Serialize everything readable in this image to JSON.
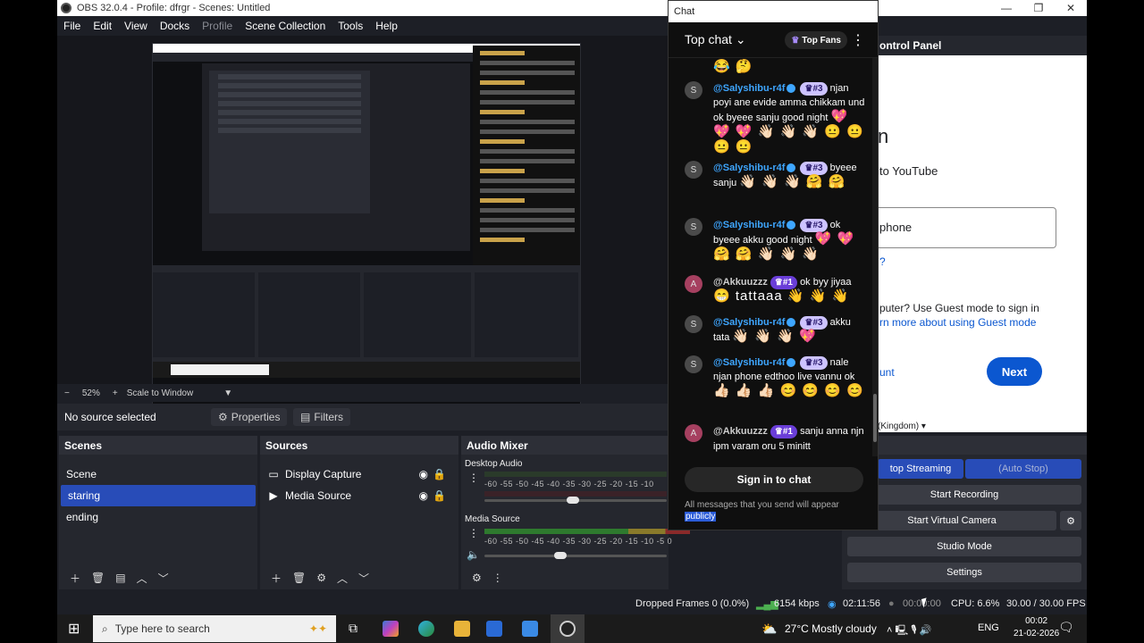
{
  "window": {
    "title": "OBS 32.0.4 - Profile: dfrgr - Scenes: Untitled",
    "minimize": "—",
    "maximize": "❐",
    "close": "✕"
  },
  "menu": [
    "File",
    "Edit",
    "View",
    "Docks",
    "Profile",
    "Scene Collection",
    "Tools",
    "Help"
  ],
  "zoom": {
    "minus": "−",
    "value": "52%",
    "plus": "+",
    "mode": "Scale to Window",
    "caret": "▼"
  },
  "properties_row": {
    "no_source": "No source selected",
    "properties": "Properties",
    "filters": "Filters"
  },
  "scenes": {
    "header": "Scenes",
    "items": [
      "Scene",
      "staring",
      "ending"
    ],
    "selected_index": 1
  },
  "sources": {
    "header": "Sources",
    "items": [
      {
        "name": "Display Capture",
        "icon": "monitor-icon"
      },
      {
        "name": "Media Source",
        "icon": "play-icon"
      }
    ]
  },
  "audio_mixer": {
    "header": "Audio Mixer",
    "channels": [
      {
        "name": "Desktop Audio",
        "scale": "-60 -55 -50 -45 -40 -35 -30 -25 -20 -15 -10",
        "volume": 0.45
      },
      {
        "name": "Media Source",
        "scale": "-60 -55 -50 -45 -40 -35 -30 -25 -20 -15 -10 -5 0",
        "volume": 0.38
      }
    ]
  },
  "controls": {
    "header_suffix": "ols",
    "buttons": {
      "stop_streaming": "top Streaming",
      "auto_stop": "(Auto Stop)",
      "start_recording": "Start Recording",
      "start_virtual_camera": "Start Virtual Camera",
      "studio_mode": "Studio Mode",
      "settings": "Settings"
    }
  },
  "control_panel": {
    "title": "ontrol Panel"
  },
  "youtube_login": {
    "heading_fragment": "n",
    "subtitle": "to YouTube",
    "input_value": "phone",
    "question": "?",
    "guest_line1": "puter? Use Guest mode to sign in",
    "guest_link": "rn more about using Guest mode",
    "create_account": "unt",
    "next": "Next",
    "language": "(Kingdom)"
  },
  "chat": {
    "window_title": "Chat",
    "mode": "Top chat",
    "fans_label": "Top Fans",
    "top_emoji": "😂 🤔",
    "messages": [
      {
        "avatar": "S",
        "user": "@Salyshibu-r4f",
        "badge": "#3",
        "text": "njan poyi ane evide amma chikkam und ok byeee sanju good night",
        "emoji": "💖 💖 💖 👋🏻 👋🏻 👋🏻 😐 😐 😐 😐"
      },
      {
        "avatar": "S",
        "user": "@Salyshibu-r4f",
        "badge": "#3",
        "text": "byeee sanju",
        "emoji": "👋🏻 👋🏻 👋🏻 🤗 🤗"
      },
      {
        "avatar": "S",
        "user": "@Salyshibu-r4f",
        "badge": "#3",
        "text": "ok byeee akku good night",
        "emoji": "💖 💖 🤗 🤗 👋🏻 👋🏻 👋🏻"
      },
      {
        "avatar": "A",
        "user": "@Akkuuzzz",
        "badge": "#1",
        "text": "ok byy jiyaa",
        "emoji": "😁 tattaaa 👋 👋 👋"
      },
      {
        "avatar": "S",
        "user": "@Salyshibu-r4f",
        "badge": "#3",
        "text": "akku tata",
        "emoji": "👋🏻 👋🏻 👋🏻 💖"
      },
      {
        "avatar": "S",
        "user": "@Salyshibu-r4f",
        "badge": "#3",
        "text": "nale njan phone edthoo live vannu ok",
        "emoji": "👍🏻 👍🏻 👍🏻 😊 😊 😊 😊"
      },
      {
        "avatar": "A",
        "user": "@Akkuuzzz",
        "badge": "#1",
        "text": "sanju anna njn ipm varam oru 5 minitt",
        "emoji": ""
      }
    ],
    "signin": "Sign in to chat",
    "note": "All messages that you send will appear",
    "note_highlight": "publicly"
  },
  "statusbar": {
    "dropped": "Dropped Frames 0 (0.0%)",
    "kbps": "6154 kbps",
    "live_time": "02:11:56",
    "rec_time": "00:00:00",
    "cpu": "CPU: 6.6%",
    "fps": "30.00 / 30.00 FPS"
  },
  "taskbar": {
    "search_placeholder": "Type here to search",
    "weather": "27°C  Mostly cloudy",
    "lang": "ENG",
    "time": "00:02",
    "date": "21-02-2026"
  },
  "colors": {
    "accent": "#284cb8",
    "bg": "#1d1f26",
    "panel": "#25272e",
    "youtube_blue": "#0b57d0",
    "link": "#3ea6ff"
  }
}
